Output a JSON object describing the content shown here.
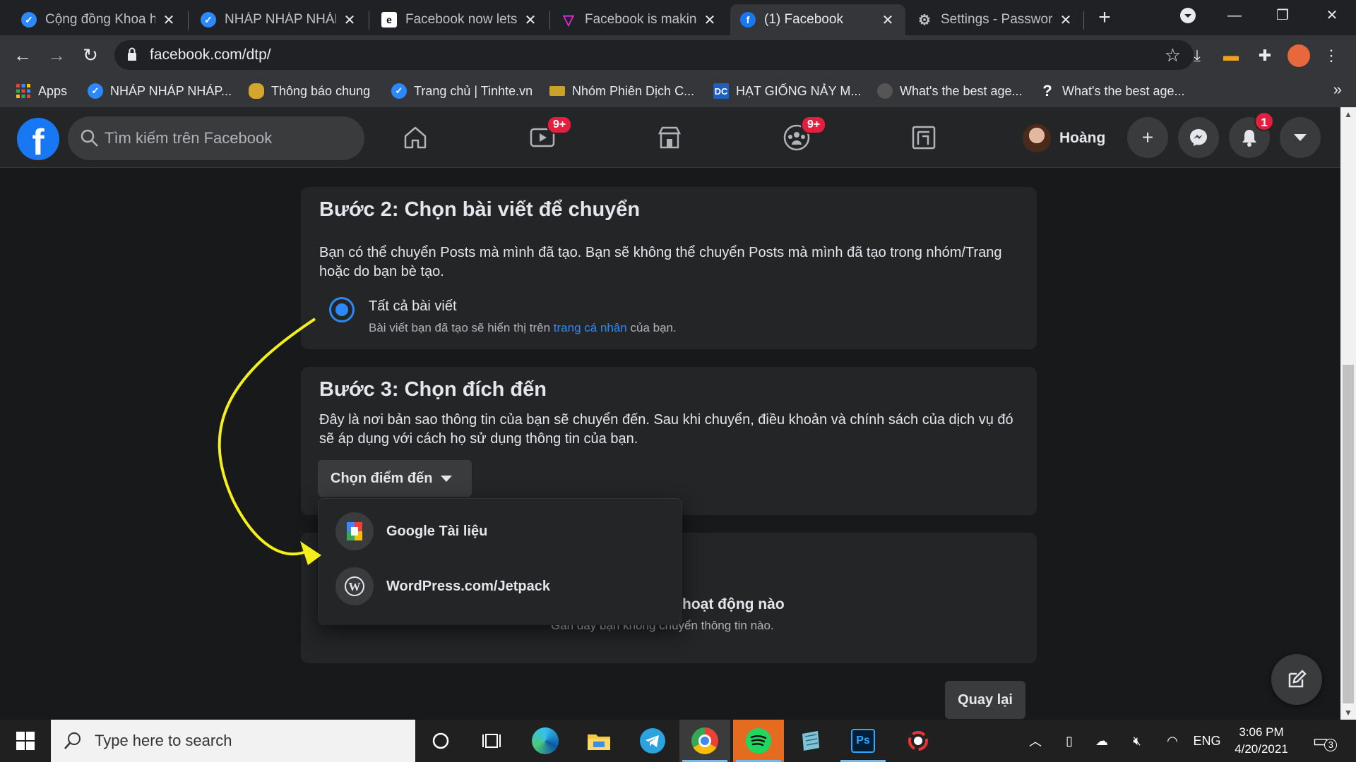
{
  "browser": {
    "tabs": [
      {
        "title": "Cộng đồng Khoa học",
        "icon": "tinhte-icon",
        "color": "#2d88ff"
      },
      {
        "title": "NHÁP NHÁP NHÁP",
        "icon": "tinhte-icon",
        "color": "#2d88ff"
      },
      {
        "title": "Facebook now lets you",
        "icon": "engadget-icon",
        "color": "#ffffff"
      },
      {
        "title": "Facebook is making",
        "icon": "verge-icon",
        "color": "#e02bde"
      },
      {
        "title": "(1) Facebook",
        "icon": "facebook-icon",
        "color": "#1877f2",
        "active": true
      },
      {
        "title": "Settings - Passwords",
        "icon": "gear-icon",
        "color": "#bdc1c6"
      }
    ],
    "url": "facebook.com/dtp/",
    "bookmarks": [
      {
        "label": "Apps",
        "icon": "apps-grid-icon"
      },
      {
        "label": "NHÁP NHÁP NHÁP...",
        "icon": "tinhte-icon"
      },
      {
        "label": "Thông báo chung",
        "icon": "chat-bubble-icon"
      },
      {
        "label": "Trang chủ | Tinhte.vn",
        "icon": "tinhte-icon"
      },
      {
        "label": "Nhóm Phiên Dịch C...",
        "icon": "flag-icon"
      },
      {
        "label": "HẠT GIỐNG NẢY M...",
        "icon": "dc-icon"
      },
      {
        "label": "What's the best age...",
        "icon": "moon-icon"
      },
      {
        "label": "What's the best age...",
        "icon": "question-icon"
      }
    ]
  },
  "facebook": {
    "search_placeholder": "Tìm kiếm trên Facebook",
    "nav": {
      "watch_badge": "9+",
      "groups_badge": "9+"
    },
    "profile_name": "Hoàng",
    "notif_count": "1"
  },
  "step2": {
    "title": "Bước 2: Chọn bài viết để chuyển",
    "desc": "Bạn có thể chuyển Posts mà mình đã tạo. Bạn sẽ không thể chuyển Posts mà mình đã tạo trong nhóm/Trang hoặc do bạn bè tạo.",
    "option_label": "Tất cả bài viết",
    "option_sub_before": "Bài viết bạn đã tạo sẽ hiển thị trên ",
    "option_sub_link": "trang cá nhân",
    "option_sub_after": " của bạn."
  },
  "step3": {
    "title": "Bước 3: Chọn đích đến",
    "desc": "Đây là nơi bản sao thông tin của bạn sẽ chuyển đến. Sau khi chuyển, điều khoản và chính sách của dịch vụ đó sẽ áp dụng với cách họ sử dụng thông tin của bạn.",
    "select_label": "Chọn điểm đến"
  },
  "dropdown": {
    "options": [
      "Google Tài liệu",
      "WordPress.com/Jetpack"
    ]
  },
  "activity": {
    "title_partial": "hoạt động nào",
    "sub": "Gần đây bạn không chuyển thông tin nào."
  },
  "back_button": "Quay lại",
  "taskbar": {
    "search_placeholder": "Type here to search",
    "lang": "ENG",
    "time": "3:06 PM",
    "date": "4/20/2021",
    "notif_count": "3"
  },
  "colors": {
    "fb_blue": "#1877f2",
    "link_blue": "#2d88ff",
    "badge_red": "#e41e3f",
    "arrow_yellow": "#f5ef1c"
  }
}
